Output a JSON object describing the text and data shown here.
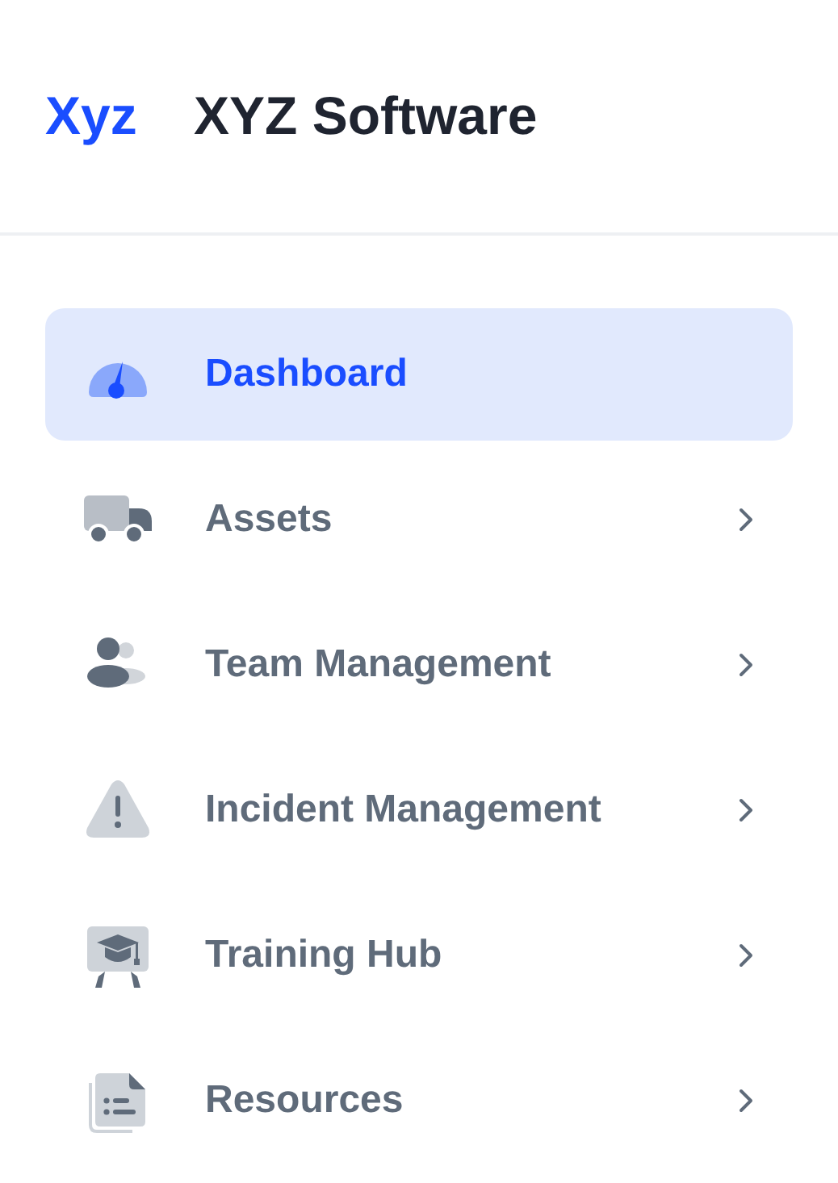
{
  "header": {
    "logo": "Xyz",
    "title": "XYZ Software"
  },
  "nav": [
    {
      "kind": "gauge",
      "label": "Dashboard",
      "selected": true,
      "has_submenu": false
    },
    {
      "kind": "truck",
      "label": "Assets",
      "selected": false,
      "has_submenu": true
    },
    {
      "kind": "people",
      "label": "Team Management",
      "selected": false,
      "has_submenu": true
    },
    {
      "kind": "warning",
      "label": "Incident Management",
      "selected": false,
      "has_submenu": true
    },
    {
      "kind": "training",
      "label": "Training Hub",
      "selected": false,
      "has_submenu": true
    },
    {
      "kind": "document",
      "label": "Resources",
      "selected": false,
      "has_submenu": true
    }
  ]
}
